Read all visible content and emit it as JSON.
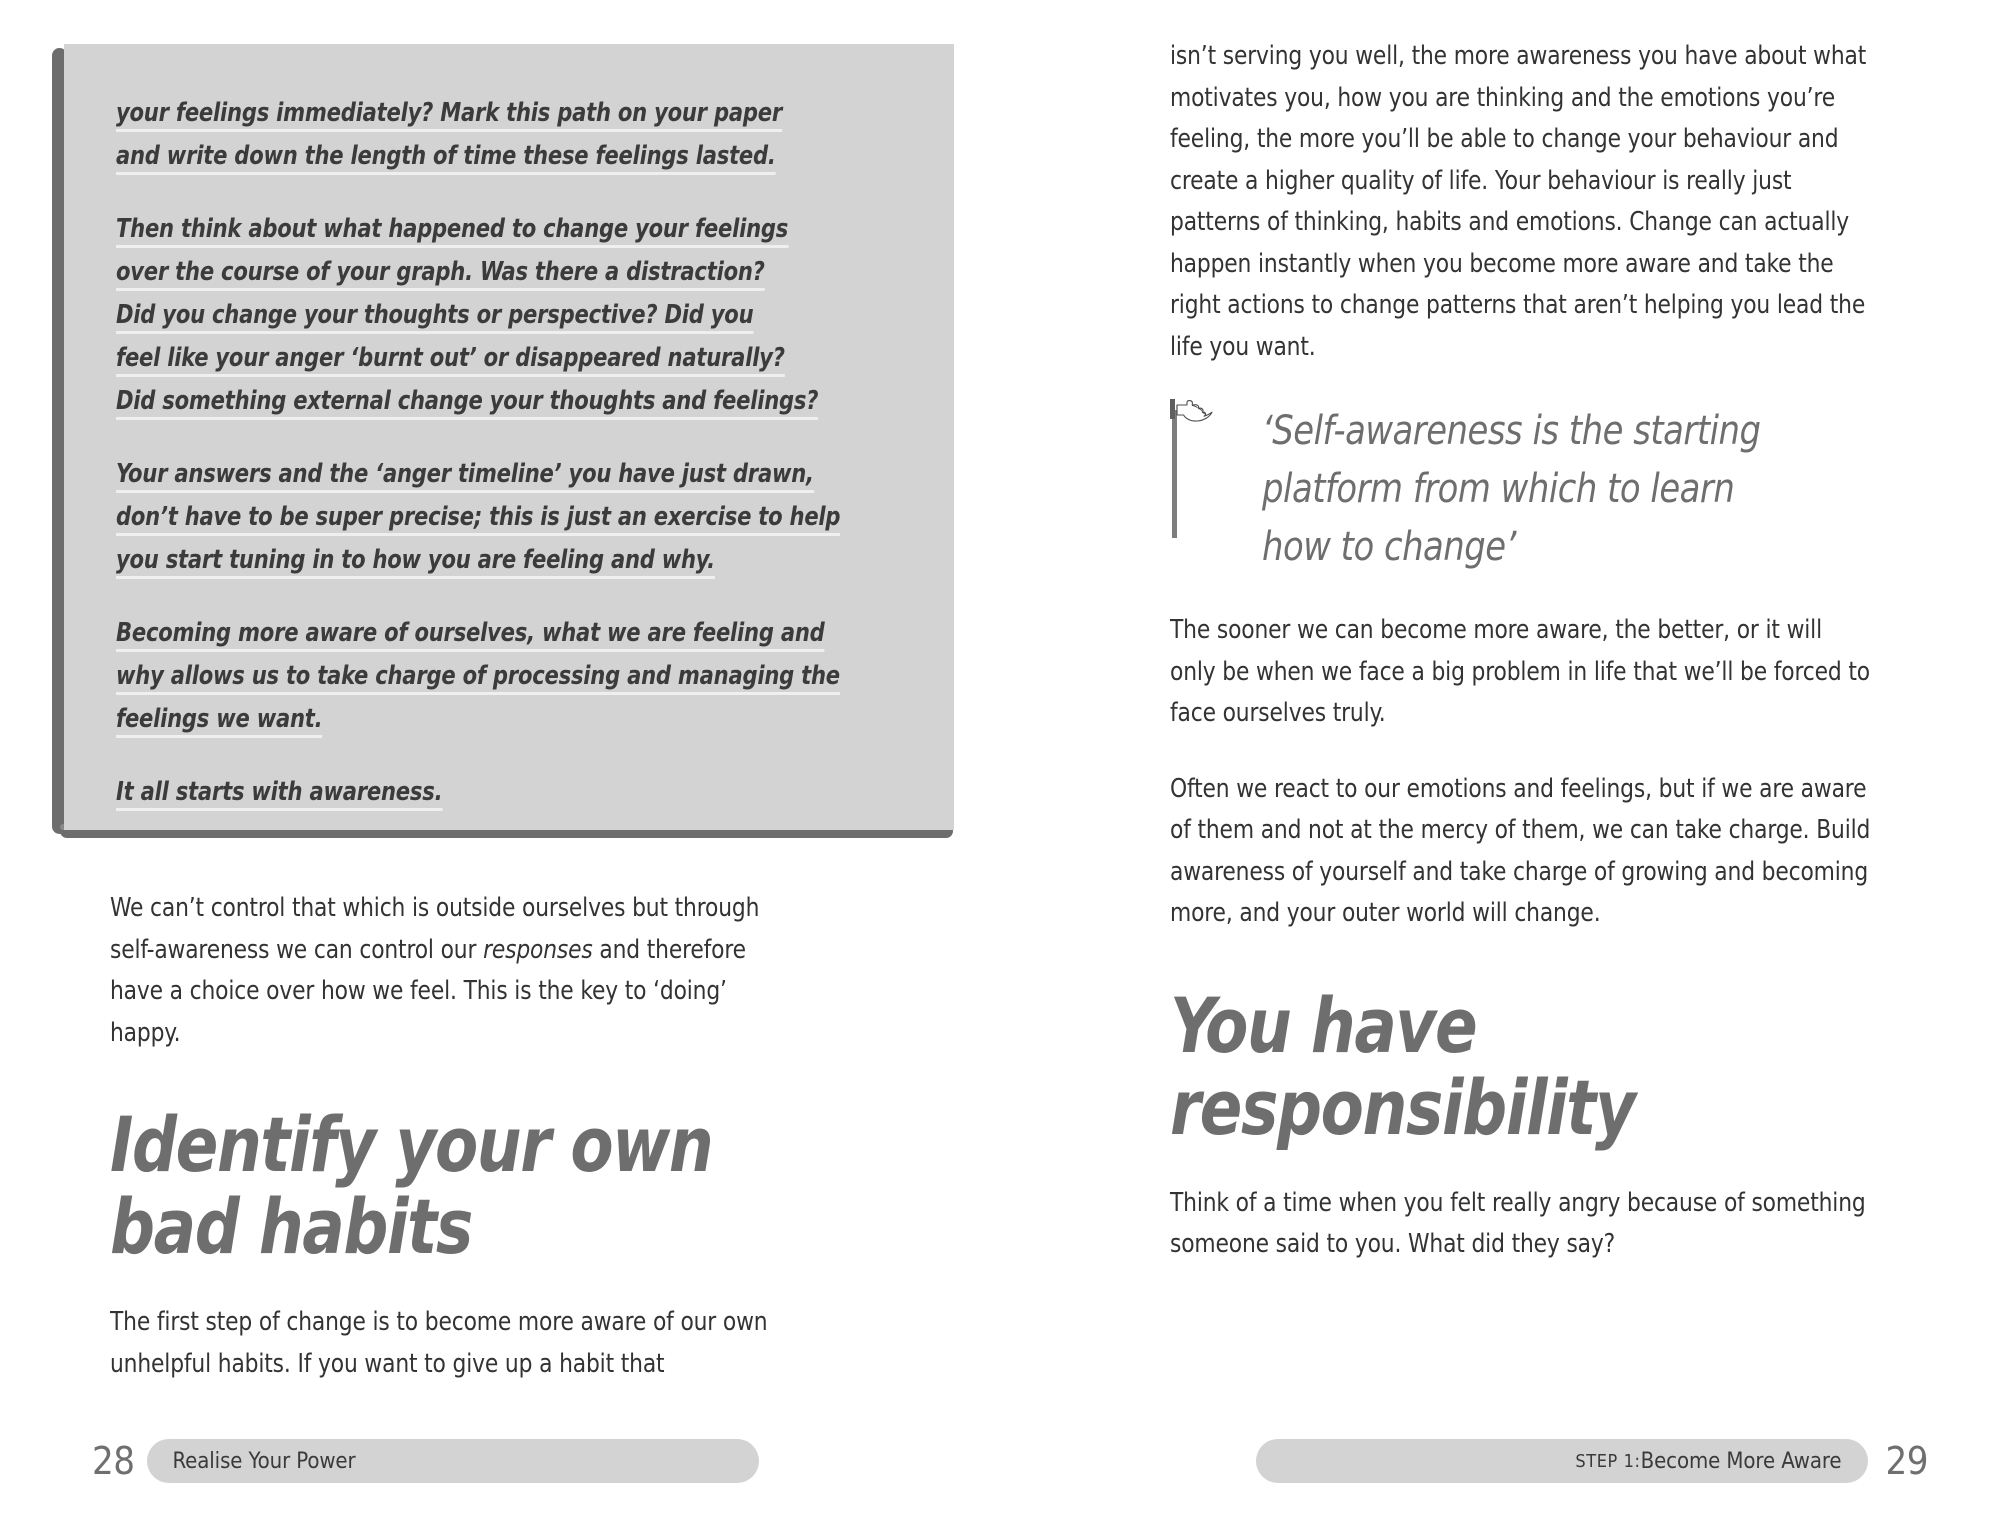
{
  "theme": {
    "page_background": "#ffffff",
    "worksheet_fill": "#d3d3d3",
    "worksheet_shadow": "#6d6d6d",
    "rule_line": "#efefef",
    "heading_color": "#6e6e6e",
    "body_color": "#333333",
    "runner_fill": "#d3d3d3"
  },
  "left_page": {
    "folio": "28",
    "runner_label": "Realise Your Power",
    "worksheet": {
      "paragraphs": [
        {
          "lines": [
            "your feelings immediately? Mark this path on your paper",
            "and write down the length of time these feelings lasted."
          ]
        },
        {
          "lines": [
            "Then think about what happened to change your feelings",
            "over the course of your graph. Was there a distraction?",
            "Did you change your thoughts or perspective? Did you",
            "feel like your anger ‘burnt out’ or disappeared naturally?",
            "Did something external change your thoughts and feelings?"
          ]
        },
        {
          "lines": [
            "Your answers and the ‘anger timeline’ you have just drawn,",
            "don’t have to be super precise; this is just an exercise to help",
            "you start tuning in to how you are feeling and why."
          ]
        },
        {
          "lines": [
            "Becoming more aware of ourselves, what we are feeling and",
            "why allows us to take charge of processing and managing the",
            "feelings we want."
          ]
        },
        {
          "lines": [
            "It all starts with awareness."
          ]
        }
      ]
    },
    "paragraph_after_box_part1": "We can’t control that which is outside ourselves but through self-awareness we can control our ",
    "paragraph_after_box_italic": "responses",
    "paragraph_after_box_part2": " and therefore have a choice over how we feel. This is the key to ‘doing’ happy.",
    "heading_line1": "Identify your own",
    "heading_line2": "bad habits",
    "paragraph_after_heading": "The first step of change is to become more aware of our own unhelpful habits. If you want to give up a habit that"
  },
  "right_page": {
    "folio": "29",
    "runner_step": "STEP 1:",
    "runner_label": " Become More Aware",
    "paragraph_top": "isn’t serving you well, the more awareness you have about what motivates you, how you are thinking and the emotions you’re feeling, the more you’ll be able to change your behaviour and create a higher quality of life. Your behaviour is really just patterns of thinking, habits and emotions. Change can actually happen instantly when you become more aware and take the right actions to change patterns that aren’t helping you lead the life you want.",
    "pullquote": {
      "icon": "pointing-hand-icon",
      "lines": [
        "‘Self-awareness is the starting",
        "platform from which to learn",
        "how to change’"
      ]
    },
    "paragraph_two": "The sooner we can become more aware, the better, or it will only be when we face a big problem in life that we’ll be forced to face ourselves truly.",
    "paragraph_three": "Often we react to our emotions and feelings, but if we are aware of them and not at the mercy of them, we can take charge. Build awareness of yourself and take charge of growing and becoming more, and your outer world will change.",
    "heading_line1": "You have",
    "heading_line2": "responsibility",
    "paragraph_after_heading": "Think of a time when you felt really angry because of something someone said to you. What did they say?"
  }
}
